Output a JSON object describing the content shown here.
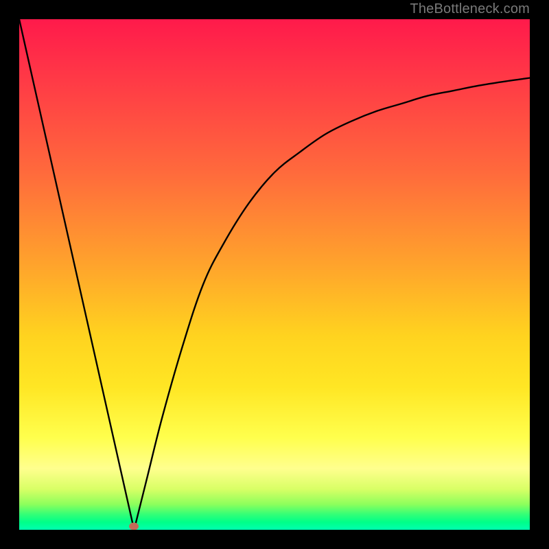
{
  "attribution": "TheBottleneck.com",
  "chart_data": {
    "type": "line",
    "title": "",
    "xlabel": "",
    "ylabel": "",
    "xlim": [
      0,
      100
    ],
    "ylim": [
      0,
      100
    ],
    "grid": false,
    "series": [
      {
        "name": "left-slope",
        "x": [
          0,
          22.5
        ],
        "values": [
          100,
          0
        ]
      },
      {
        "name": "right-curve",
        "x": [
          22.5,
          25,
          28,
          32,
          36,
          40,
          45,
          50,
          55,
          60,
          65,
          70,
          75,
          80,
          85,
          90,
          95,
          100
        ],
        "values": [
          0,
          10,
          22,
          36,
          48,
          56,
          64,
          70,
          74,
          77.5,
          80,
          82,
          83.5,
          85,
          86,
          87,
          87.8,
          88.5
        ]
      }
    ],
    "marker": {
      "x": 22.5,
      "y": 0.7,
      "color": "#c46a58"
    },
    "colors": {
      "curve": "#000000",
      "background_gradient": [
        "#ff1a4b",
        "#ff6a3c",
        "#ffd31f",
        "#ffff4d",
        "#00ff88"
      ],
      "frame": "#000000"
    }
  }
}
